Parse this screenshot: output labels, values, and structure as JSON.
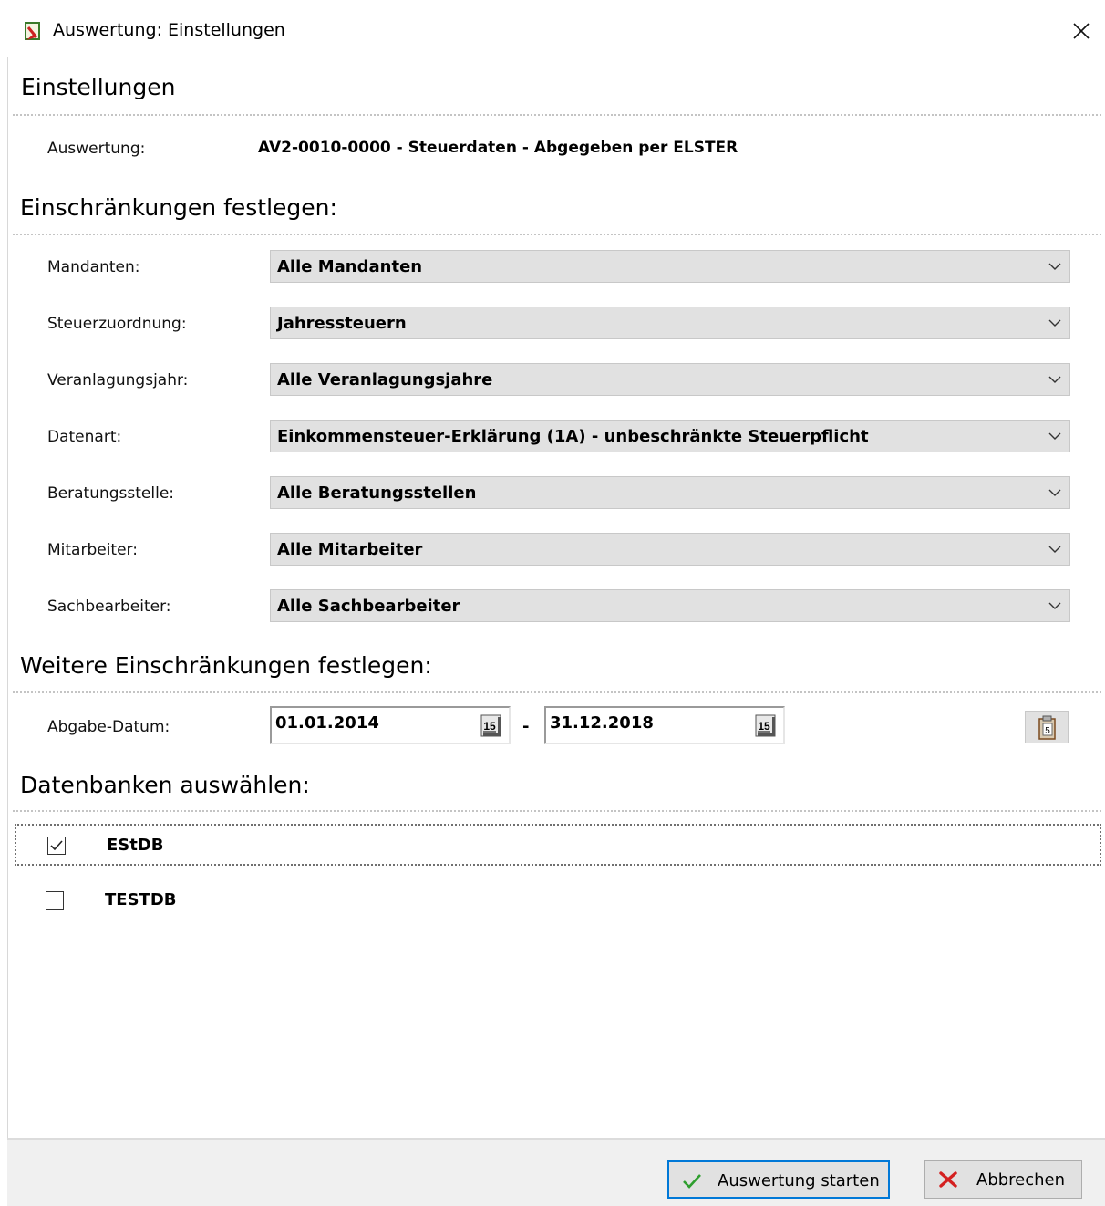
{
  "window": {
    "title": "Auswertung: Einstellungen"
  },
  "header": {
    "title": "Einstellungen",
    "auswertung_label": "Auswertung:",
    "auswertung_value": "AV2-0010-0000 - Steuerdaten - Abgegeben per ELSTER"
  },
  "restrictions": {
    "title": "Einschränkungen festlegen:",
    "fields": [
      {
        "label": "Mandanten:",
        "value": "Alle Mandanten"
      },
      {
        "label": "Steuerzuordnung:",
        "value": "Jahressteuern"
      },
      {
        "label": "Veranlagungsjahr:",
        "value": "Alle Veranlagungsjahre"
      },
      {
        "label": "Datenart:",
        "value": "Einkommensteuer-Erklärung (1A) - unbeschränkte Steuerpflicht"
      },
      {
        "label": "Beratungsstelle:",
        "value": "Alle Beratungsstellen"
      },
      {
        "label": "Mitarbeiter:",
        "value": "Alle Mitarbeiter"
      },
      {
        "label": "Sachbearbeiter:",
        "value": "Alle Sachbearbeiter"
      }
    ]
  },
  "more_restrictions": {
    "title": "Weitere Einschränkungen festlegen:",
    "date_label": "Abgabe-Datum:",
    "date_from": "01.01.2014",
    "date_separator": "-",
    "date_to": "31.12.2018",
    "calendar_glyph": "15"
  },
  "databases": {
    "title": "Datenbanken auswählen:",
    "items": [
      {
        "name": "EStDB",
        "checked": true
      },
      {
        "name": "TESTDB",
        "checked": false
      }
    ]
  },
  "footer": {
    "start_label": "Auswertung starten",
    "cancel_label": "Abbrechen"
  },
  "colors": {
    "combo_bg": "#e1e1e1",
    "default_button_border": "#0078d7",
    "check_green": "#2e9e2e",
    "cancel_red": "#d42020"
  }
}
